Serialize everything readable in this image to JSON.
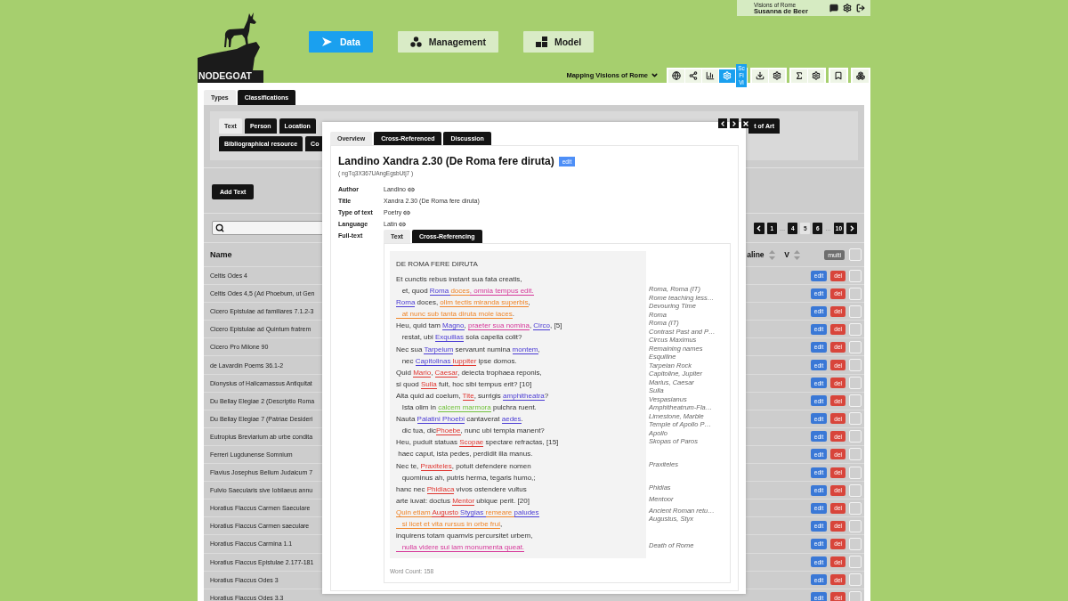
{
  "header": {
    "logo_text": "NODEGOAT",
    "nav": [
      {
        "label": "Data",
        "kind": "data",
        "selected": true
      },
      {
        "label": "Management",
        "kind": "management",
        "selected": false
      },
      {
        "label": "Model",
        "kind": "model",
        "selected": false
      }
    ],
    "user": {
      "project": "Visions of Rome",
      "name": "Susanna de Beer"
    },
    "toolbar": {
      "project_menu": "Mapping Visions of Rome",
      "scope_badge": [
        "Sc",
        "Fi",
        "Vi"
      ],
      "groups": [
        {
          "items": [
            {
              "kind": "globe",
              "active": false
            },
            {
              "kind": "network",
              "active": false
            },
            {
              "kind": "chart",
              "active": false
            },
            {
              "kind": "settings",
              "active": true
            }
          ]
        },
        {
          "items": [
            {
              "kind": "download",
              "active": false
            },
            {
              "kind": "settings",
              "active": false
            }
          ]
        },
        {
          "items": [
            {
              "kind": "sigma",
              "active": false
            },
            {
              "kind": "settings",
              "active": false
            }
          ]
        },
        {
          "items": [
            {
              "kind": "bookmark",
              "active": false
            }
          ]
        },
        {
          "items": [
            {
              "kind": "layers",
              "active": false
            }
          ]
        }
      ]
    }
  },
  "top_tabs": [
    {
      "label": "Types",
      "selected": true
    },
    {
      "label": "Classifications",
      "selected": false
    }
  ],
  "type_tab_rows": [
    {
      "tabs": [
        {
          "label": "Text",
          "selected": true
        },
        {
          "label": "Person",
          "selected": false
        },
        {
          "label": "Location",
          "selected": false
        },
        {
          "label": "t of Art",
          "selected": false
        }
      ]
    },
    {
      "tabs": [
        {
          "label": "Bibliographical resource",
          "selected": false
        },
        {
          "label": "Co",
          "selected": false
        }
      ]
    }
  ],
  "add_button": "Add Text",
  "pagination": [
    {
      "label": "1",
      "kind": "page",
      "selected": false
    },
    {
      "label": "…",
      "kind": "gap"
    },
    {
      "label": "4",
      "kind": "page",
      "selected": false
    },
    {
      "label": "5",
      "kind": "page",
      "selected": true
    },
    {
      "label": "6",
      "kind": "page",
      "selected": false
    },
    {
      "label": "…",
      "kind": "gap"
    },
    {
      "label": "10",
      "kind": "page",
      "selected": false
    }
  ],
  "table": {
    "columns": {
      "name": "Name",
      "column_2": "aline",
      "column_3": "V",
      "multi": "multi",
      "checked": false
    },
    "rows": [
      {
        "name": "Celtis Odes 4",
        "actions": [
          "edit",
          "del"
        ],
        "checked": false
      },
      {
        "name": "Celtis Odes 4,5 (Ad Phoebum, ut Gen",
        "actions": [
          "edit",
          "del"
        ],
        "checked": false
      },
      {
        "name": "Cicero Epistulae ad familiares 7.1.2-3",
        "actions": [
          "edit",
          "del"
        ],
        "checked": false
      },
      {
        "name": "Cicero Epistulae ad Quintum fratrem",
        "actions": [
          "edit",
          "del"
        ],
        "checked": false
      },
      {
        "name": "Cicero Pro Milone 90",
        "actions": [
          "edit",
          "del"
        ],
        "checked": false
      },
      {
        "name": "de Lavardin Poems 36.1-2",
        "actions": [
          "edit",
          "del"
        ],
        "checked": false
      },
      {
        "name": "Dionysius of Halicarnassus Antiquitat",
        "actions": [
          "edit",
          "del"
        ],
        "checked": false
      },
      {
        "name": "Du Bellay Elegiae 2 (Descriptio Roma",
        "actions": [
          "edit",
          "del"
        ],
        "checked": false
      },
      {
        "name": "Du Bellay Elegiae 7 (Patriae Desideri",
        "actions": [
          "edit",
          "del"
        ],
        "checked": false
      },
      {
        "name": "Eutropius Breviarium ab urbe condita",
        "actions": [
          "edit",
          "del"
        ],
        "checked": false
      },
      {
        "name": "Ferreri Lugdunense Somnium",
        "actions": [
          "edit",
          "del"
        ],
        "checked": false
      },
      {
        "name": "Flavius Josephus Bellum Judaicum 7",
        "actions": [
          "edit",
          "del"
        ],
        "checked": false
      },
      {
        "name": "Fulvio Saecularis sive Iobilaeus annu",
        "actions": [
          "edit",
          "del"
        ],
        "checked": false
      },
      {
        "name": "Horatius Flaccus Carmen Saeculare",
        "actions": [
          "edit",
          "del"
        ],
        "checked": false
      },
      {
        "name": "Horatius Flaccus Carmen saeculare",
        "actions": [
          "edit",
          "del"
        ],
        "checked": false
      },
      {
        "name": "Horatius Flaccus Carmina 1.1",
        "actions": [
          "edit",
          "del"
        ],
        "checked": false
      },
      {
        "name": "Horatius Flaccus Epistulae 2.177-181",
        "actions": [
          "edit",
          "del"
        ],
        "checked": false
      },
      {
        "name": "Horatius Flaccus Odes 3",
        "actions": [
          "edit",
          "del"
        ],
        "checked": false
      },
      {
        "name": "Horatius Flaccus Odes 3.3",
        "actions": [
          "edit",
          "del"
        ],
        "checked": false
      }
    ]
  },
  "modal": {
    "tabs": [
      {
        "label": "Overview",
        "selected": true
      },
      {
        "label": "Cross-Referenced",
        "selected": false
      },
      {
        "label": "Discussion",
        "selected": false
      }
    ],
    "title": "Landino Xandra 2.30 (De Roma fere diruta)",
    "edit": "edit",
    "id": "( ngTq3X367UAngEgsbUtj7 )",
    "fields": [
      {
        "label": "Author",
        "value": "Landino",
        "linked": true
      },
      {
        "label": "Title",
        "value": "Xandra 2.30 (De Roma fere diruta)",
        "linked": false
      },
      {
        "label": "Type of text",
        "value": "Poetry",
        "linked": true
      },
      {
        "label": "Language",
        "value": "Latin",
        "linked": true
      }
    ],
    "fulltext_label": "Full-text",
    "subtabs": [
      {
        "label": "Text",
        "selected": true
      },
      {
        "label": "Cross-Referencing",
        "selected": false
      }
    ],
    "poem": {
      "heading": "DE ROMA FERE DIRUTA",
      "lines": [
        {
          "segments": [
            {
              "text": "Et cunctis rebus instant sua fata creatis,"
            }
          ]
        },
        {
          "segments": [
            {
              "text": "   et, quod "
            },
            {
              "text": "Roma ",
              "color": "#4a3bd4"
            },
            {
              "text": "doces",
              "color": "#f0862a"
            },
            {
              "text": ", omnia tempus edit.",
              "color": "#d6379a"
            }
          ],
          "notes": [
            "Roma, Roma (IT)",
            "Rome teaching less…",
            "Devouring Time",
            "Roma",
            "Roma (IT)",
            "Contrast Past and P…",
            "Circus Maximus",
            "Remaining names",
            "Esquiline",
            "Tarpeian Rock",
            "Capitoline, Jupiter",
            "Marius, Caesar",
            "Sulla",
            "Vespasianus",
            "Amphitheatrum-Fla…",
            "Limestone, Marble",
            "Temple of Apollo P…",
            "Apollo",
            "Skopas of Paros"
          ]
        },
        {
          "segments": [
            {
              "text": "Roma",
              "color": "#4a3bd4"
            },
            {
              "text": " doces, "
            },
            {
              "text": "olim tectis miranda superbis",
              "color": "#f0862a"
            },
            {
              "text": ","
            }
          ]
        },
        {
          "segments": [
            {
              "text": "   at nunc sub tanta diruta mole iaces",
              "color": "#f0862a"
            },
            {
              "text": "."
            }
          ]
        },
        {
          "segments": [
            {
              "text": "Heu, quid tam "
            },
            {
              "text": "Magno",
              "color": "#4a3bd4"
            },
            {
              "text": ", "
            },
            {
              "text": "praeter sua nomina",
              "color": "#d6379a"
            },
            {
              "text": ", "
            },
            {
              "text": "Circo",
              "color": "#4a3bd4"
            },
            {
              "text": ", [5]"
            }
          ]
        },
        {
          "segments": [
            {
              "text": "   restat, ubi "
            },
            {
              "text": "Exquilias",
              "color": "#4a3bd4"
            },
            {
              "text": " sola capella colit?"
            }
          ]
        },
        {
          "segments": [
            {
              "text": "Nec sua "
            },
            {
              "text": "Tarpeium",
              "color": "#4a3bd4"
            },
            {
              "text": " servarunt numina "
            },
            {
              "text": "montem",
              "color": "#4a3bd4"
            },
            {
              "text": ","
            }
          ]
        },
        {
          "segments": [
            {
              "text": "   nec "
            },
            {
              "text": "Capitolinas ",
              "color": "#4a3bd4"
            },
            {
              "text": "Iuppiter",
              "color": "#e0352f"
            },
            {
              "text": " ipse domos."
            }
          ]
        },
        {
          "segments": [
            {
              "text": "Quid "
            },
            {
              "text": "Mario",
              "color": "#e0352f"
            },
            {
              "text": ", "
            },
            {
              "text": "Caesar",
              "color": "#e0352f"
            },
            {
              "text": ", deiecta trophaea reponis,"
            }
          ]
        },
        {
          "segments": [
            {
              "text": "si quod "
            },
            {
              "text": "Sulla",
              "color": "#e0352f"
            },
            {
              "text": " fuit, hoc sibi tempus erit? [10]"
            }
          ]
        },
        {
          "segments": [
            {
              "text": "Alta quid ad coelum, "
            },
            {
              "text": "Tite",
              "color": "#e0352f"
            },
            {
              "text": ", surrigis "
            },
            {
              "text": "amphitheatra",
              "color": "#4a3bd4"
            },
            {
              "text": "?"
            }
          ]
        },
        {
          "segments": [
            {
              "text": "   Ista olim in "
            },
            {
              "text": "calcem ",
              "color": "#72c23c"
            },
            {
              "text": "marmora",
              "color": "#72c23c"
            },
            {
              "text": " pulchra ruent."
            }
          ]
        },
        {
          "segments": [
            {
              "text": "Nauta "
            },
            {
              "text": "Palatini Phoebi",
              "color": "#4a3bd4"
            },
            {
              "text": " cantaverat "
            },
            {
              "text": "aedes",
              "color": "#4a3bd4"
            },
            {
              "text": "."
            }
          ]
        },
        {
          "segments": [
            {
              "text": "   dic tua, dic"
            },
            {
              "text": "Phoebe",
              "color": "#e0352f"
            },
            {
              "text": ", nunc ubi templa manent?"
            }
          ]
        },
        {
          "segments": [
            {
              "text": "Heu, puduit statuas "
            },
            {
              "text": "Scopae",
              "color": "#e0352f"
            },
            {
              "text": " spectare refractas, [15]"
            }
          ]
        },
        {
          "segments": [
            {
              "text": " haec caput, ista pedes, perdidit illa manus."
            }
          ]
        },
        {
          "segments": [
            {
              "text": "Nec te, "
            },
            {
              "text": "Praxiteles",
              "color": "#e0352f"
            },
            {
              "text": ", potuit defendere nomen"
            }
          ],
          "notes": [
            "Praxiteles"
          ]
        },
        {
          "segments": [
            {
              "text": "   quominus ah, putris herma, tegaris humo,;"
            }
          ]
        },
        {
          "segments": [
            {
              "text": "hanc nec "
            },
            {
              "text": "Phidiaca",
              "color": "#e0352f"
            },
            {
              "text": " vivos ostendere vultus"
            }
          ],
          "notes": [
            "Phidias"
          ]
        },
        {
          "segments": [
            {
              "text": "arte iuvat: doctus "
            },
            {
              "text": "Mentor",
              "color": "#e0352f"
            },
            {
              "text": " ubique perit. [20]"
            }
          ],
          "notes": [
            "Mentoor"
          ]
        },
        {
          "segments": [
            {
              "text": "Quin etiam ",
              "color": "#f0862a"
            },
            {
              "text": "Augusto ",
              "color": "#e0352f"
            },
            {
              "text": "Stygias ",
              "color": "#4a3bd4"
            },
            {
              "text": "remeare ",
              "color": "#f0862a"
            },
            {
              "text": "paludes",
              "color": "#4a3bd4"
            }
          ],
          "notes": [
            "Ancient Roman retu…",
            "Augustus, Styx"
          ]
        },
        {
          "segments": [
            {
              "text": "   si licet et vita rursus in orbe frui",
              "color": "#f0862a"
            },
            {
              "text": ","
            }
          ]
        },
        {
          "segments": [
            {
              "text": "inquirens totam quamvis percursitet urbem,"
            }
          ]
        },
        {
          "segments": [
            {
              "text": "   nulla videre sui iam monumenta queat.",
              "color": "#d6379a"
            }
          ],
          "notes": [
            "Death of Rome"
          ]
        }
      ]
    },
    "word_count": "Word Count: 158"
  }
}
